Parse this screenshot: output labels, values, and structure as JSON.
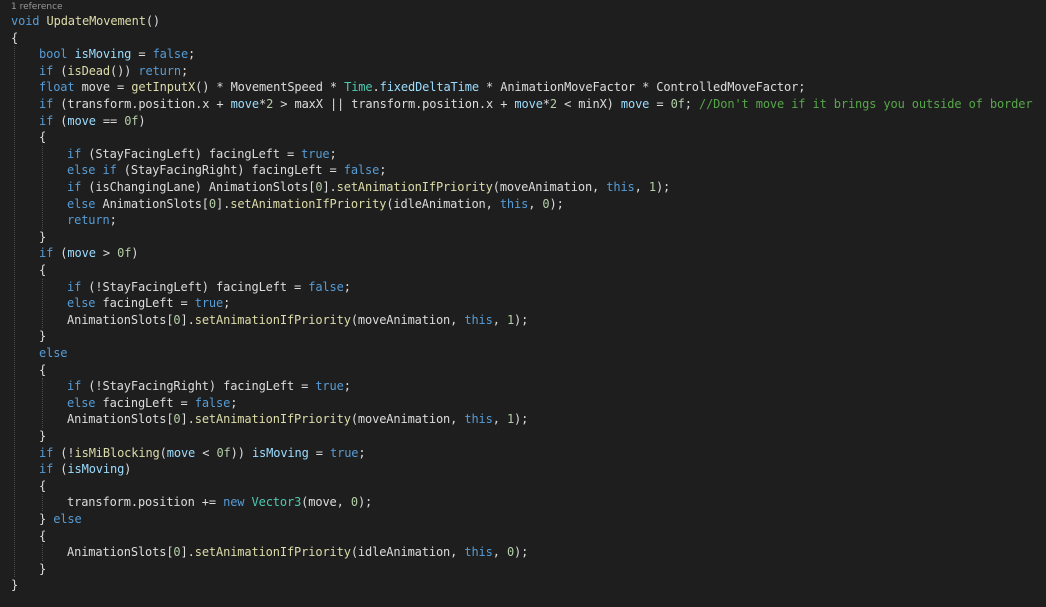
{
  "editor": {
    "codelens": "1 reference",
    "colors": {
      "background": "#1e1e1e",
      "text": "#dcdcdc",
      "keyword": "#569cd6",
      "method": "#dcdcaa",
      "field": "#9cdcfe",
      "type": "#4ec9b0",
      "number": "#b5cea8",
      "comment": "#57a64a",
      "indent_guide": "#4a4a4a"
    },
    "lines": [
      {
        "indent": 0,
        "tokens": [
          [
            "kw",
            "void"
          ],
          [
            "t",
            " "
          ],
          [
            "m",
            "UpdateMovement"
          ],
          [
            "t",
            "()"
          ]
        ]
      },
      {
        "indent": 0,
        "tokens": [
          [
            "t",
            "{"
          ]
        ]
      },
      {
        "indent": 1,
        "tokens": [
          [
            "kw",
            "bool"
          ],
          [
            "t",
            " "
          ],
          [
            "f",
            "isMoving"
          ],
          [
            "t",
            " = "
          ],
          [
            "kw",
            "false"
          ],
          [
            "t",
            ";"
          ]
        ]
      },
      {
        "indent": 1,
        "tokens": [
          [
            "kw",
            "if"
          ],
          [
            "t",
            " ("
          ],
          [
            "m",
            "isDead"
          ],
          [
            "t",
            "()) "
          ],
          [
            "kw",
            "return"
          ],
          [
            "t",
            ";"
          ]
        ]
      },
      {
        "indent": 1,
        "tokens": [
          [
            "kw",
            "float"
          ],
          [
            "t",
            " move = "
          ],
          [
            "m",
            "getInputX"
          ],
          [
            "t",
            "() * MovementSpeed * "
          ],
          [
            "ty",
            "Time"
          ],
          [
            "t",
            "."
          ],
          [
            "f",
            "fixedDeltaTime"
          ],
          [
            "t",
            " * AnimationMoveFactor * ControlledMoveFactor;"
          ]
        ]
      },
      {
        "indent": 1,
        "tokens": [
          [
            "kw",
            "if"
          ],
          [
            "t",
            " (transform.position.x + "
          ],
          [
            "f",
            "move"
          ],
          [
            "t",
            "*"
          ],
          [
            "n",
            "2"
          ],
          [
            "t",
            " > maxX || transform.position.x + "
          ],
          [
            "f",
            "move"
          ],
          [
            "t",
            "*"
          ],
          [
            "n",
            "2"
          ],
          [
            "t",
            " < minX) "
          ],
          [
            "f",
            "move"
          ],
          [
            "t",
            " = "
          ],
          [
            "n",
            "0f"
          ],
          [
            "t",
            "; "
          ],
          [
            "c",
            "//Don't move if it brings you outside of border"
          ]
        ]
      },
      {
        "indent": 1,
        "tokens": [
          [
            "kw",
            "if"
          ],
          [
            "t",
            " ("
          ],
          [
            "f",
            "move"
          ],
          [
            "t",
            " == "
          ],
          [
            "n",
            "0f"
          ],
          [
            "t",
            ")"
          ]
        ]
      },
      {
        "indent": 1,
        "tokens": [
          [
            "t",
            "{"
          ]
        ]
      },
      {
        "indent": 2,
        "tokens": [
          [
            "kw",
            "if"
          ],
          [
            "t",
            " (StayFacingLeft) facingLeft = "
          ],
          [
            "kw",
            "true"
          ],
          [
            "t",
            ";"
          ]
        ]
      },
      {
        "indent": 2,
        "tokens": [
          [
            "kw",
            "else"
          ],
          [
            "t",
            " "
          ],
          [
            "kw",
            "if"
          ],
          [
            "t",
            " (StayFacingRight) facingLeft = "
          ],
          [
            "kw",
            "false"
          ],
          [
            "t",
            ";"
          ]
        ]
      },
      {
        "indent": 2,
        "tokens": [
          [
            "kw",
            "if"
          ],
          [
            "t",
            " (isChangingLane) AnimationSlots["
          ],
          [
            "n",
            "0"
          ],
          [
            "t",
            "]."
          ],
          [
            "m",
            "setAnimationIfPriority"
          ],
          [
            "t",
            "(moveAnimation, "
          ],
          [
            "kw",
            "this"
          ],
          [
            "t",
            ", "
          ],
          [
            "n",
            "1"
          ],
          [
            "t",
            ");"
          ]
        ]
      },
      {
        "indent": 2,
        "tokens": [
          [
            "kw",
            "else"
          ],
          [
            "t",
            " AnimationSlots["
          ],
          [
            "n",
            "0"
          ],
          [
            "t",
            "]."
          ],
          [
            "m",
            "setAnimationIfPriority"
          ],
          [
            "t",
            "(idleAnimation, "
          ],
          [
            "kw",
            "this"
          ],
          [
            "t",
            ", "
          ],
          [
            "n",
            "0"
          ],
          [
            "t",
            ");"
          ]
        ]
      },
      {
        "indent": 2,
        "tokens": [
          [
            "kw",
            "return"
          ],
          [
            "t",
            ";"
          ]
        ]
      },
      {
        "indent": 1,
        "tokens": [
          [
            "t",
            "}"
          ]
        ]
      },
      {
        "indent": 1,
        "tokens": [
          [
            "kw",
            "if"
          ],
          [
            "t",
            " ("
          ],
          [
            "f",
            "move"
          ],
          [
            "t",
            " > "
          ],
          [
            "n",
            "0f"
          ],
          [
            "t",
            ")"
          ]
        ]
      },
      {
        "indent": 1,
        "tokens": [
          [
            "t",
            "{"
          ]
        ]
      },
      {
        "indent": 2,
        "tokens": [
          [
            "kw",
            "if"
          ],
          [
            "t",
            " (!StayFacingLeft) facingLeft = "
          ],
          [
            "kw",
            "false"
          ],
          [
            "t",
            ";"
          ]
        ]
      },
      {
        "indent": 2,
        "tokens": [
          [
            "kw",
            "else"
          ],
          [
            "t",
            " facingLeft = "
          ],
          [
            "kw",
            "true"
          ],
          [
            "t",
            ";"
          ]
        ]
      },
      {
        "indent": 2,
        "tokens": [
          [
            "t",
            "AnimationSlots["
          ],
          [
            "n",
            "0"
          ],
          [
            "t",
            "]."
          ],
          [
            "m",
            "setAnimationIfPriority"
          ],
          [
            "t",
            "(moveAnimation, "
          ],
          [
            "kw",
            "this"
          ],
          [
            "t",
            ", "
          ],
          [
            "n",
            "1"
          ],
          [
            "t",
            ");"
          ]
        ]
      },
      {
        "indent": 1,
        "tokens": [
          [
            "t",
            "}"
          ]
        ]
      },
      {
        "indent": 1,
        "tokens": [
          [
            "kw",
            "else"
          ]
        ]
      },
      {
        "indent": 1,
        "tokens": [
          [
            "t",
            "{"
          ]
        ]
      },
      {
        "indent": 2,
        "tokens": [
          [
            "kw",
            "if"
          ],
          [
            "t",
            " (!StayFacingRight) facingLeft = "
          ],
          [
            "kw",
            "true"
          ],
          [
            "t",
            ";"
          ]
        ]
      },
      {
        "indent": 2,
        "tokens": [
          [
            "kw",
            "else"
          ],
          [
            "t",
            " facingLeft = "
          ],
          [
            "kw",
            "false"
          ],
          [
            "t",
            ";"
          ]
        ]
      },
      {
        "indent": 2,
        "tokens": [
          [
            "t",
            "AnimationSlots["
          ],
          [
            "n",
            "0"
          ],
          [
            "t",
            "]."
          ],
          [
            "m",
            "setAnimationIfPriority"
          ],
          [
            "t",
            "(moveAnimation, "
          ],
          [
            "kw",
            "this"
          ],
          [
            "t",
            ", "
          ],
          [
            "n",
            "1"
          ],
          [
            "t",
            ");"
          ]
        ]
      },
      {
        "indent": 1,
        "tokens": [
          [
            "t",
            "}"
          ]
        ]
      },
      {
        "indent": 1,
        "tokens": [
          [
            "kw",
            "if"
          ],
          [
            "t",
            " (!"
          ],
          [
            "m",
            "isMiBlocking"
          ],
          [
            "t",
            "("
          ],
          [
            "f",
            "move"
          ],
          [
            "t",
            " < "
          ],
          [
            "n",
            "0f"
          ],
          [
            "t",
            ")) "
          ],
          [
            "f",
            "isMoving"
          ],
          [
            "t",
            " = "
          ],
          [
            "kw",
            "true"
          ],
          [
            "t",
            ";"
          ]
        ]
      },
      {
        "indent": 1,
        "tokens": [
          [
            "kw",
            "if"
          ],
          [
            "t",
            " ("
          ],
          [
            "f",
            "isMoving"
          ],
          [
            "t",
            ")"
          ]
        ]
      },
      {
        "indent": 1,
        "tokens": [
          [
            "t",
            "{"
          ]
        ]
      },
      {
        "indent": 2,
        "tokens": [
          [
            "t",
            "transform.position += "
          ],
          [
            "kw",
            "new"
          ],
          [
            "t",
            " "
          ],
          [
            "ty",
            "Vector3"
          ],
          [
            "t",
            "(move, "
          ],
          [
            "n",
            "0"
          ],
          [
            "t",
            ");"
          ]
        ]
      },
      {
        "indent": 1,
        "tokens": [
          [
            "t",
            "} "
          ],
          [
            "kw",
            "else"
          ]
        ]
      },
      {
        "indent": 1,
        "tokens": [
          [
            "t",
            "{"
          ]
        ]
      },
      {
        "indent": 2,
        "tokens": [
          [
            "t",
            "AnimationSlots["
          ],
          [
            "n",
            "0"
          ],
          [
            "t",
            "]."
          ],
          [
            "m",
            "setAnimationIfPriority"
          ],
          [
            "t",
            "(idleAnimation, "
          ],
          [
            "kw",
            "this"
          ],
          [
            "t",
            ", "
          ],
          [
            "n",
            "0"
          ],
          [
            "t",
            ");"
          ]
        ]
      },
      {
        "indent": 1,
        "tokens": [
          [
            "t",
            "}"
          ]
        ]
      },
      {
        "indent": 0,
        "tokens": [
          [
            "t",
            "}"
          ]
        ]
      }
    ]
  }
}
